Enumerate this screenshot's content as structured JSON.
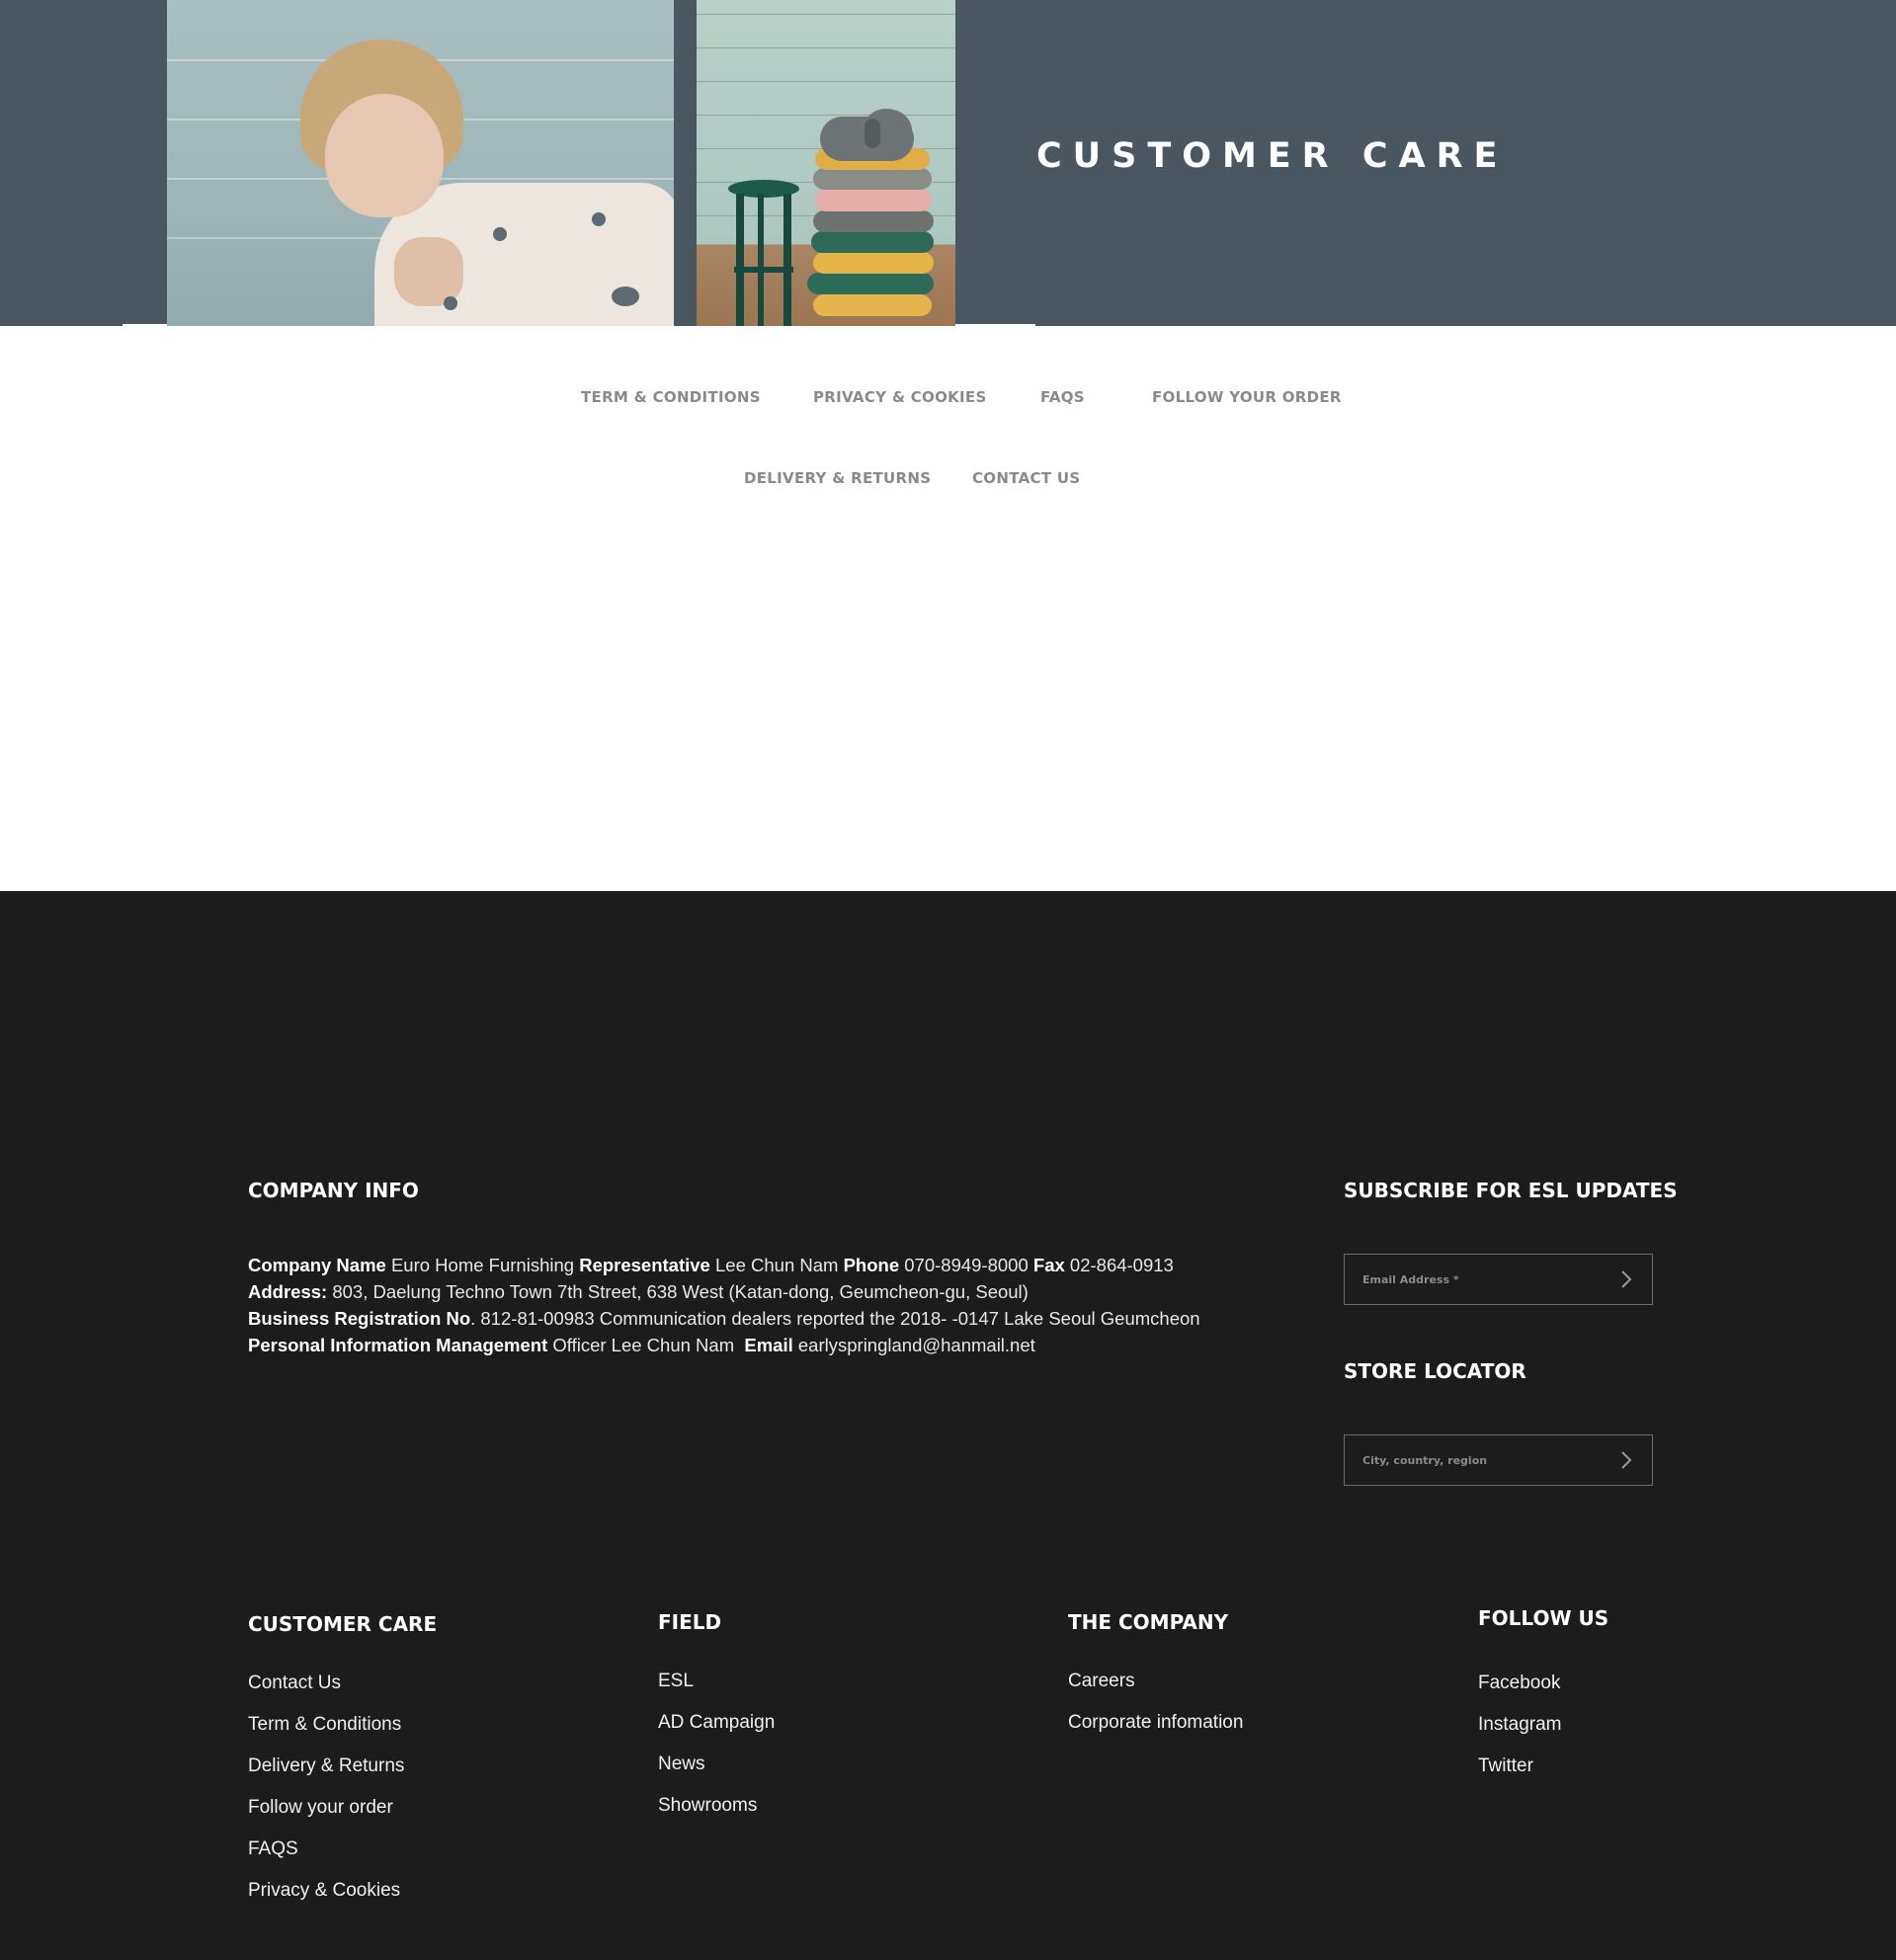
{
  "hero": {
    "title": "CUSTOMER CARE"
  },
  "subnav": {
    "row1": [
      "TERM & CONDITIONS",
      "PRIVACY & COOKIES",
      "FAQS",
      "FOLLOW YOUR ORDER"
    ],
    "row2": [
      "DELIVERY & RETURNS",
      "CONTACT US"
    ]
  },
  "company_info": {
    "heading": "COMPANY INFO",
    "company_name_label": "Company Name",
    "company_name": "Euro Home Furnishing",
    "representative_label": "Representative",
    "representative": "Lee Chun Nam",
    "phone_label": "Phone",
    "phone": "070-8949-8000",
    "fax_label": "Fax",
    "fax": "02-864-0913",
    "address_label": "Address:",
    "address": "803, Daelung Techno Town 7th Street, 638 West (Katan-dong, Geumcheon-gu, Seoul)",
    "brn_label": "Business Registration No",
    "brn": ". 812-81-00983 Communication dealers reported the 2018- -0147 Lake Seoul Geumcheon",
    "pim_label": "Personal Information Management",
    "pim": "Officer Lee Chun Nam",
    "email_label": "Email",
    "email": "earlyspringland@hanmail.net"
  },
  "subscribe": {
    "heading": "SUBSCRIBE FOR ESL UPDATES",
    "placeholder": "Email Address *"
  },
  "store_locator": {
    "heading": "STORE LOCATOR",
    "placeholder": "City, country, region"
  },
  "columns": {
    "customer_care": {
      "heading": "CUSTOMER CARE",
      "links": [
        "Contact Us",
        "Term & Conditions",
        "Delivery & Returns",
        "Follow your order",
        "FAQS",
        "Privacy & Cookies"
      ]
    },
    "field": {
      "heading": "FIELD",
      "links": [
        "ESL",
        "AD Campaign",
        "News",
        "Showrooms"
      ]
    },
    "the_company": {
      "heading": "THE COMPANY",
      "links": [
        "Careers",
        "Corporate infomation"
      ]
    },
    "follow_us": {
      "heading": "FOLLOW US",
      "links": [
        "Facebook",
        "Instagram",
        "Twitter"
      ]
    }
  },
  "colors": {
    "hero_bg": "#4a5760",
    "footer_bg": "#1c1c1c",
    "nav_text": "#8a8a8a"
  },
  "icons": {
    "submit": "chevron-right-icon"
  }
}
